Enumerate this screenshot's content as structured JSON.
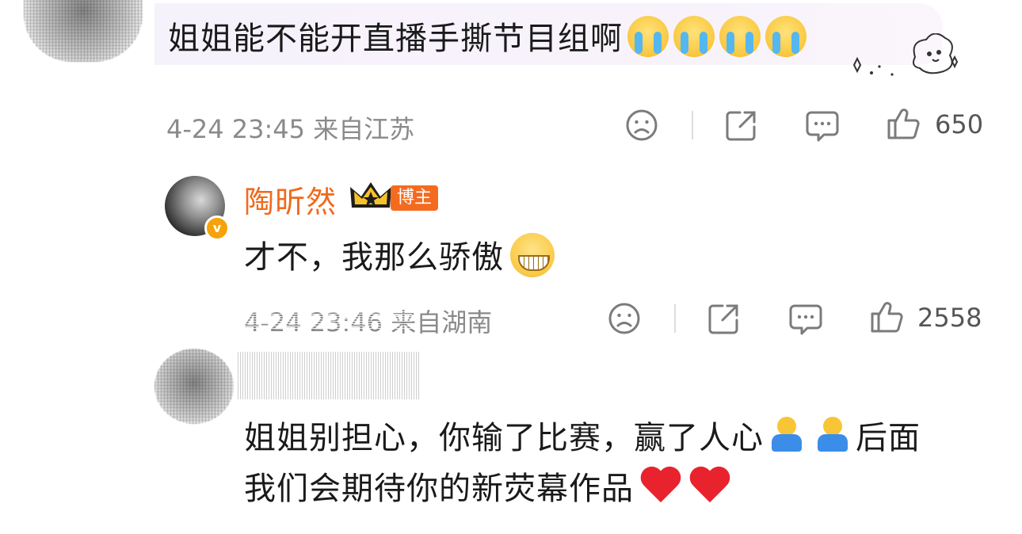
{
  "top_comment": {
    "text": "姐姐能不能开直播手撕节目组啊",
    "emoji_icons": [
      "crying-face-icon",
      "crying-face-icon",
      "crying-face-icon",
      "crying-face-icon"
    ],
    "meta": "4-24 23:45 来自江苏",
    "like_count": "650"
  },
  "reply": {
    "author": "陶昕然",
    "badge_label": "博主",
    "verified_label": "v",
    "text": "才不，我那么骄傲",
    "meta": "4-24 23:46 来自湖南",
    "like_count": "2558"
  },
  "bottom_comment": {
    "line1": "姐姐别担心，你输了比赛，赢了人心",
    "line1_after": "后面",
    "line2": "我们会期待你的新荧幕作品"
  },
  "colors": {
    "author_name": "#f06a1c",
    "badge_bg": "#f46b20",
    "meta_text": "#8a8a8a",
    "icon": "#7b7b7b",
    "bubble_bg": "#f6f2fb"
  }
}
